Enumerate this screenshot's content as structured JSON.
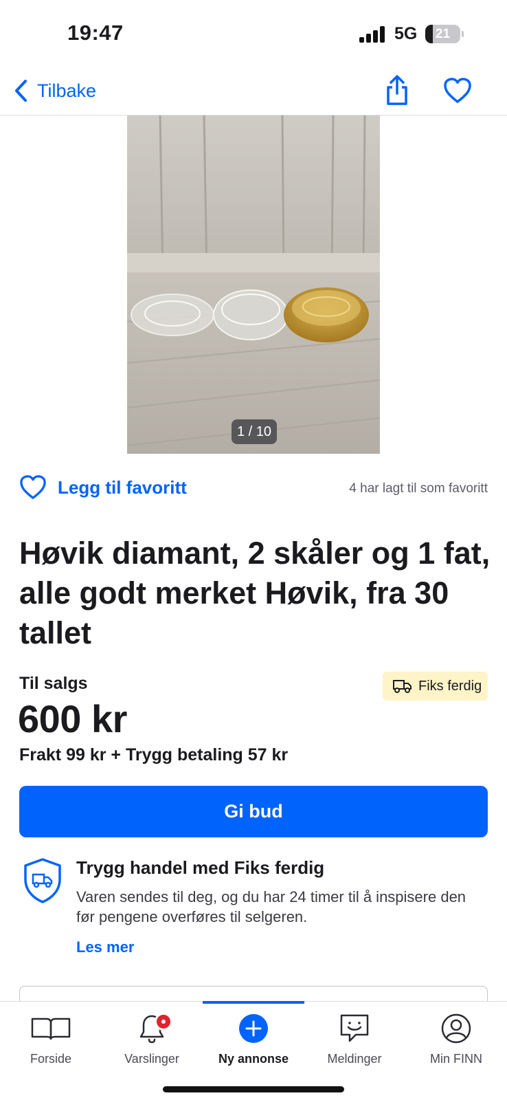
{
  "status_bar": {
    "time": "19:47",
    "network": "5G",
    "battery": "21",
    "battery_level": 0.21
  },
  "nav": {
    "back_label": "Tilbake",
    "share_icon": "share-icon",
    "favorite_icon": "heart-icon"
  },
  "gallery": {
    "counter": "1 / 10"
  },
  "favorite": {
    "add_label": "Legg til favoritt",
    "count_text": "4 har lagt til som favoritt"
  },
  "ad": {
    "title": "Høvik diamant, 2 skåler og 1 fat, alle godt merket Høvik, fra 30 tallet",
    "sale_type": "Til salgs",
    "badge": "Fiks ferdig",
    "price": "600 kr",
    "shipping": "Frakt 99 kr + Trygg betaling 57 kr",
    "bid_label": "Gi bud"
  },
  "safe_trade": {
    "title": "Trygg handel med Fiks ferdig",
    "text": "Varen sendes til deg, og du har 24 timer til å inspisere den før pengene overføres til selgeren.",
    "link": "Les mer"
  },
  "tabs": [
    {
      "label": "Forside",
      "icon": "book-icon"
    },
    {
      "label": "Varslinger",
      "icon": "bell-icon"
    },
    {
      "label": "Ny annonse",
      "icon": "plus-icon"
    },
    {
      "label": "Meldinger",
      "icon": "chat-icon"
    },
    {
      "label": "Min FINN",
      "icon": "profile-icon"
    }
  ],
  "colors": {
    "accent": "#0063fb",
    "badge_bg": "#fff4c8",
    "notification": "#e1232e"
  }
}
